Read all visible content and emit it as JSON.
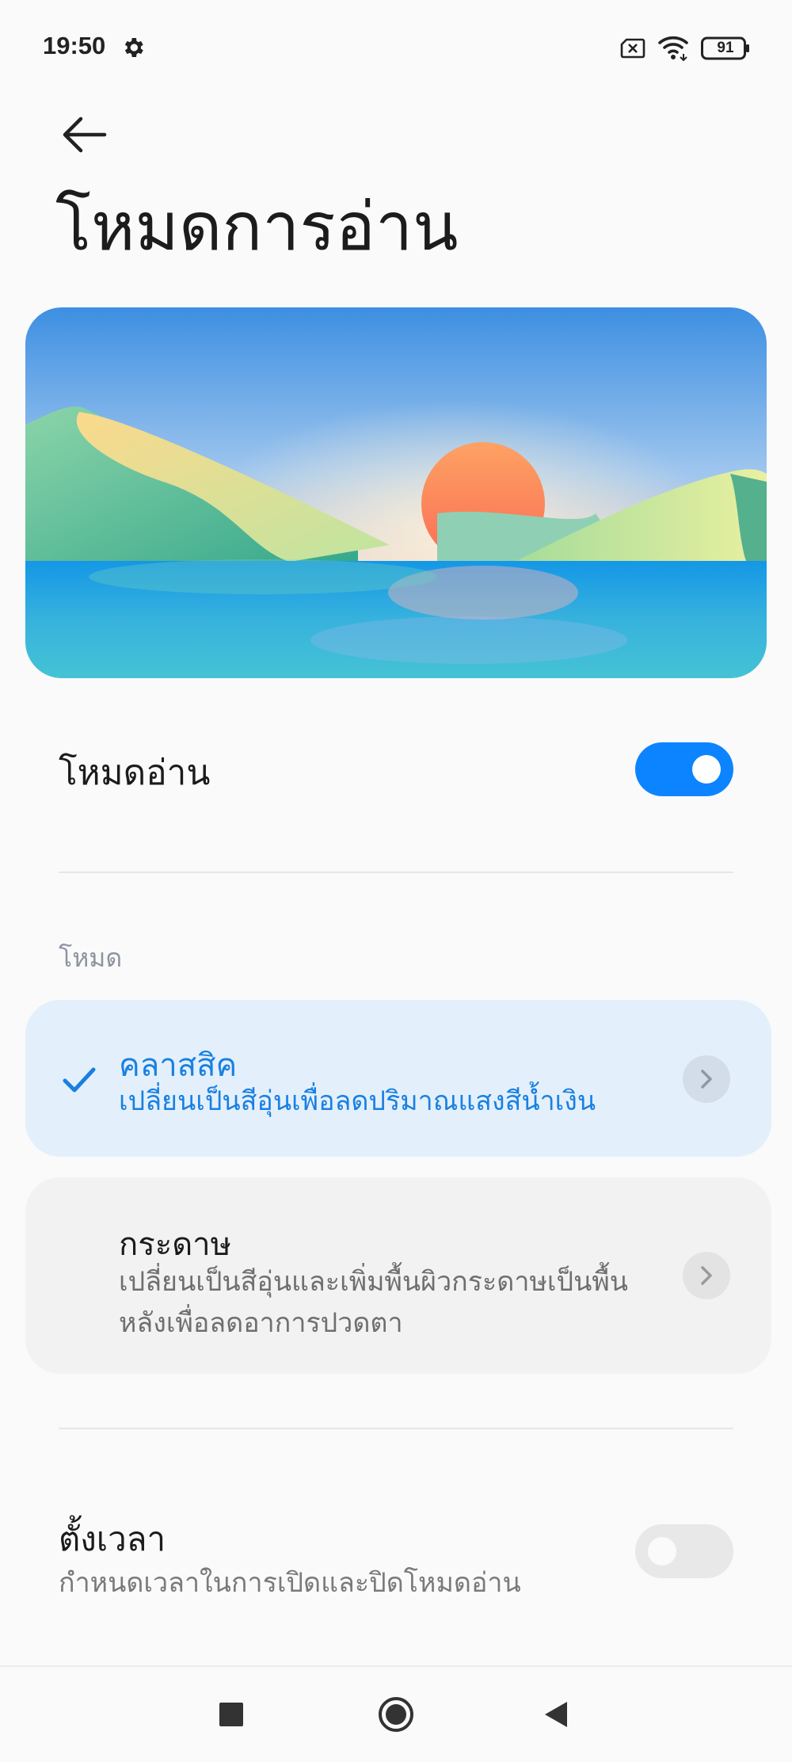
{
  "status": {
    "time": "19:50",
    "battery": "91"
  },
  "header": {
    "title": "โหมดการอ่าน"
  },
  "reading_mode": {
    "label": "โหมดอ่าน",
    "enabled": true
  },
  "modes": {
    "section_label": "โหมด",
    "classic": {
      "title": "คลาสสิค",
      "description": "เปลี่ยนเป็นสีอุ่นเพื่อลดปริมาณแสงสีน้ำเงิน",
      "selected": true
    },
    "paper": {
      "title": "กระดาษ",
      "description": "เปลี่ยนเป็นสีอุ่นและเพิ่มพื้นผิวกระดาษเป็นพื้นหลังเพื่อลดอาการปวดตา",
      "selected": false
    }
  },
  "schedule": {
    "label": "ตั้งเวลา",
    "description": "กำหนดเวลาในการเปิดและปิดโหมดอ่าน",
    "enabled": false
  },
  "colors": {
    "accent": "#0d84ff",
    "selected_card": "#e3f0fc",
    "selected_text": "#1a80e0"
  },
  "icons": [
    "settings-gear-icon",
    "sim-error-icon",
    "wifi-icon",
    "battery-icon",
    "back-arrow-icon",
    "checkmark-icon",
    "chevron-right-icon",
    "recents-square-icon",
    "home-circle-icon",
    "back-triangle-icon"
  ]
}
